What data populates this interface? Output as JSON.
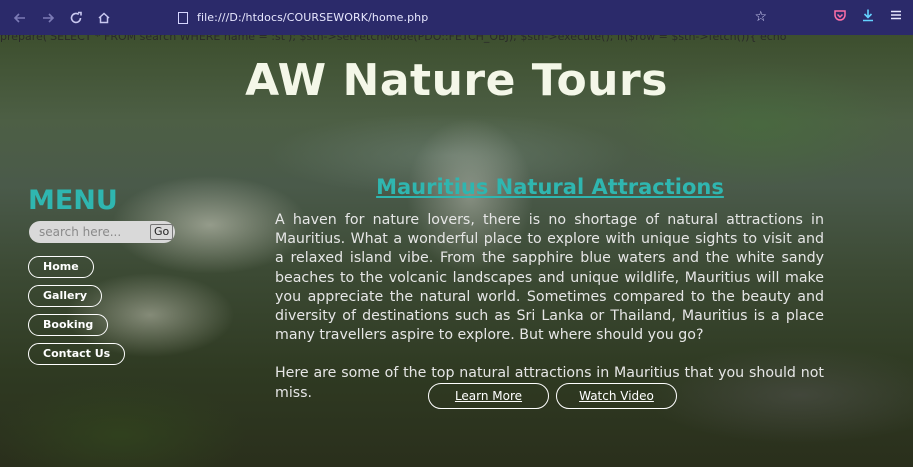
{
  "browser": {
    "url": "file:///D:/htdocs/COURSEWORK/home.php",
    "icons": [
      "back-icon",
      "forward-icon",
      "reload-icon",
      "home-icon",
      "bookmark-star-icon",
      "pocket-icon",
      "download-icon",
      "menu-icon"
    ]
  },
  "page": {
    "php_error_text": "prepare('SELECT * FROM search WHERE name = :st'); $stn->setFetchMode(PDO::FETCH_OBJ); $stn->execute(); if($row = $stn->fetch()){ echo",
    "site_title": "AW Nature Tours",
    "sidebar": {
      "menu_title": "MENU",
      "search_placeholder": "search here...",
      "go_label": "Go",
      "links": [
        "Home",
        "Gallery",
        "Booking",
        "Contact Us"
      ]
    },
    "content": {
      "heading": "Mauritius Natural Attractions",
      "paragraph1": "A haven for nature lovers, there is no shortage of natural attractions in Mauritius. What a wonderful place to explore with unique sights to visit and a relaxed island vibe. From the sapphire blue waters and the white sandy beaches to the volcanic landscapes and unique wildlife, Mauritius will make you appreciate the natural world. Sometimes compared to the beauty and diversity of destinations such as Sri Lanka or Thailand, Mauritius is a place many travellers aspire to explore. But where should you go?",
      "paragraph2": "Here are some of the top natural attractions in Mauritius that you should not miss.",
      "buttons": [
        "Learn More",
        "Watch Video"
      ]
    }
  },
  "colors": {
    "toolbar": "#2b2a6a",
    "accent_teal": "#2fb6b0",
    "title_text": "#f4f7e8"
  }
}
